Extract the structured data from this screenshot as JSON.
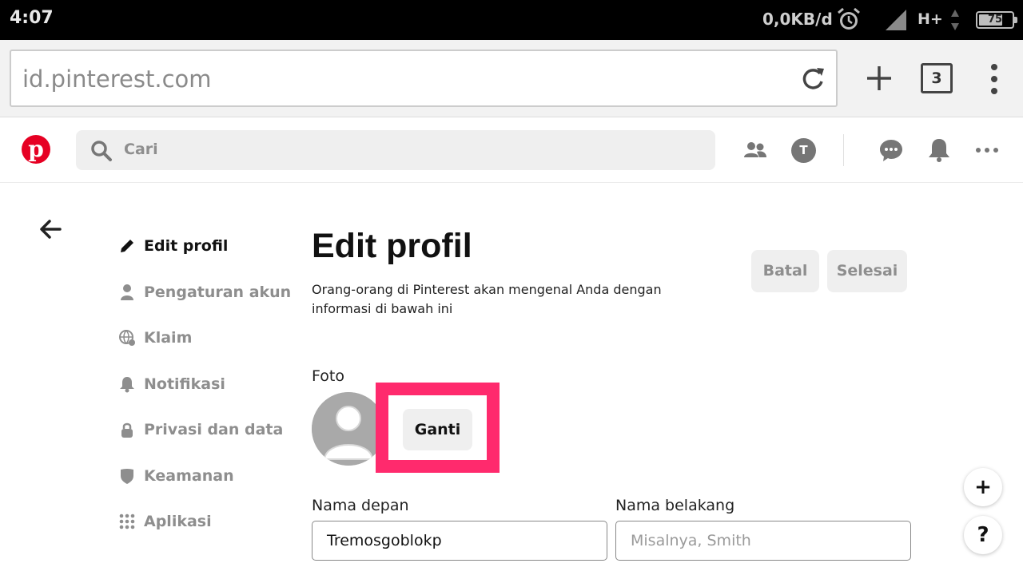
{
  "status_bar": {
    "time": "4:07",
    "net_speed": "0,0KB/d",
    "network_type": "H+",
    "battery": "75",
    "battery_level_pct": 75,
    "icons": [
      "alarm-icon",
      "signal-icon",
      "data-arrows-icon",
      "battery-icon"
    ]
  },
  "browser": {
    "url": "id.pinterest.com",
    "tab_count": "3",
    "icons": [
      "reload-icon",
      "new-tab-plus-icon",
      "menu-kebab-icon"
    ]
  },
  "header": {
    "search_placeholder": "Cari",
    "avatar_letter": "T",
    "brand_color": "#e60023",
    "icons": [
      "search-icon",
      "people-icon",
      "messages-icon",
      "notifications-bell-icon",
      "more-dots-icon"
    ]
  },
  "sidebar": {
    "items": [
      {
        "label": "Edit profil",
        "icon": "pencil-icon",
        "active": true
      },
      {
        "label": "Pengaturan akun",
        "icon": "person-icon",
        "active": false
      },
      {
        "label": "Klaim",
        "icon": "globe-icon",
        "active": false
      },
      {
        "label": "Notifikasi",
        "icon": "bell-icon",
        "active": false
      },
      {
        "label": "Privasi dan data",
        "icon": "lock-icon",
        "active": false
      },
      {
        "label": "Keamanan",
        "icon": "shield-icon",
        "active": false
      },
      {
        "label": "Aplikasi",
        "icon": "grid-icon",
        "active": false
      }
    ]
  },
  "main": {
    "title": "Edit profil",
    "subtitle": "Orang-orang di Pinterest akan mengenal Anda dengan informasi di bawah ini",
    "cancel_label": "Batal",
    "done_label": "Selesai",
    "photo_label": "Foto",
    "change_label": "Ganti",
    "highlight_color": "#ff2a6d",
    "first_name_label": "Nama depan",
    "first_name_value": "Tremosgoblokp",
    "last_name_label": "Nama belakang",
    "last_name_placeholder": "Misalnya, Smith"
  },
  "fabs": {
    "add_label": "+",
    "help_label": "?"
  }
}
